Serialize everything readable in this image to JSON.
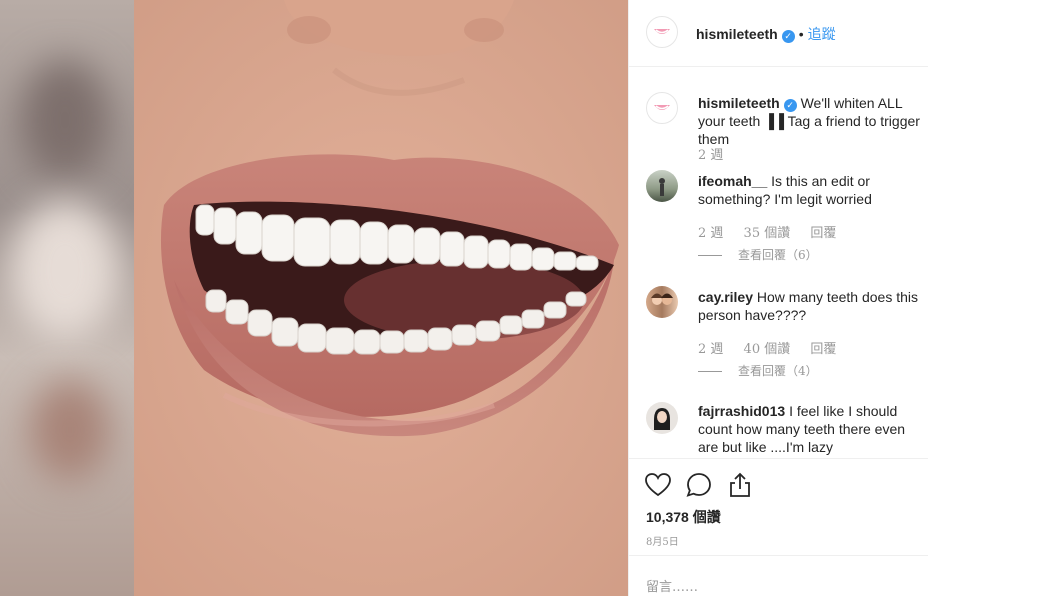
{
  "post": {
    "author": "hismileteeth",
    "follow_label": "追蹤",
    "separator": "•",
    "caption": "We'll whiten ALL your teeth ▐▐ Tag a friend to trigger them",
    "caption_time": "2 週"
  },
  "comments": [
    {
      "username": "ifeomah__",
      "text": "Is this an edit or something? I'm legit worried",
      "time": "2 週",
      "likes": "35 個讚",
      "reply_label": "回覆",
      "view_replies": "查看回覆（6）"
    },
    {
      "username": "cay.riley",
      "text": "How many teeth does this person have????",
      "time": "2 週",
      "likes": "40 個讚",
      "reply_label": "回覆",
      "view_replies": "查看回覆（4）"
    },
    {
      "username": "fajrrashid013",
      "text": "I feel like I should count how many teeth there even are but like ....I'm lazy"
    }
  ],
  "actions": {
    "like_icon": "heart-icon",
    "comment_icon": "comment-bubble-icon",
    "share_icon": "share-icon"
  },
  "stats": {
    "likes": "10,378 個讚",
    "date": "8月5日"
  },
  "add_comment_placeholder": "留言……",
  "colors": {
    "accent": "#3897f0",
    "text": "#262626",
    "muted": "#999999",
    "lip": "#c67a72"
  }
}
